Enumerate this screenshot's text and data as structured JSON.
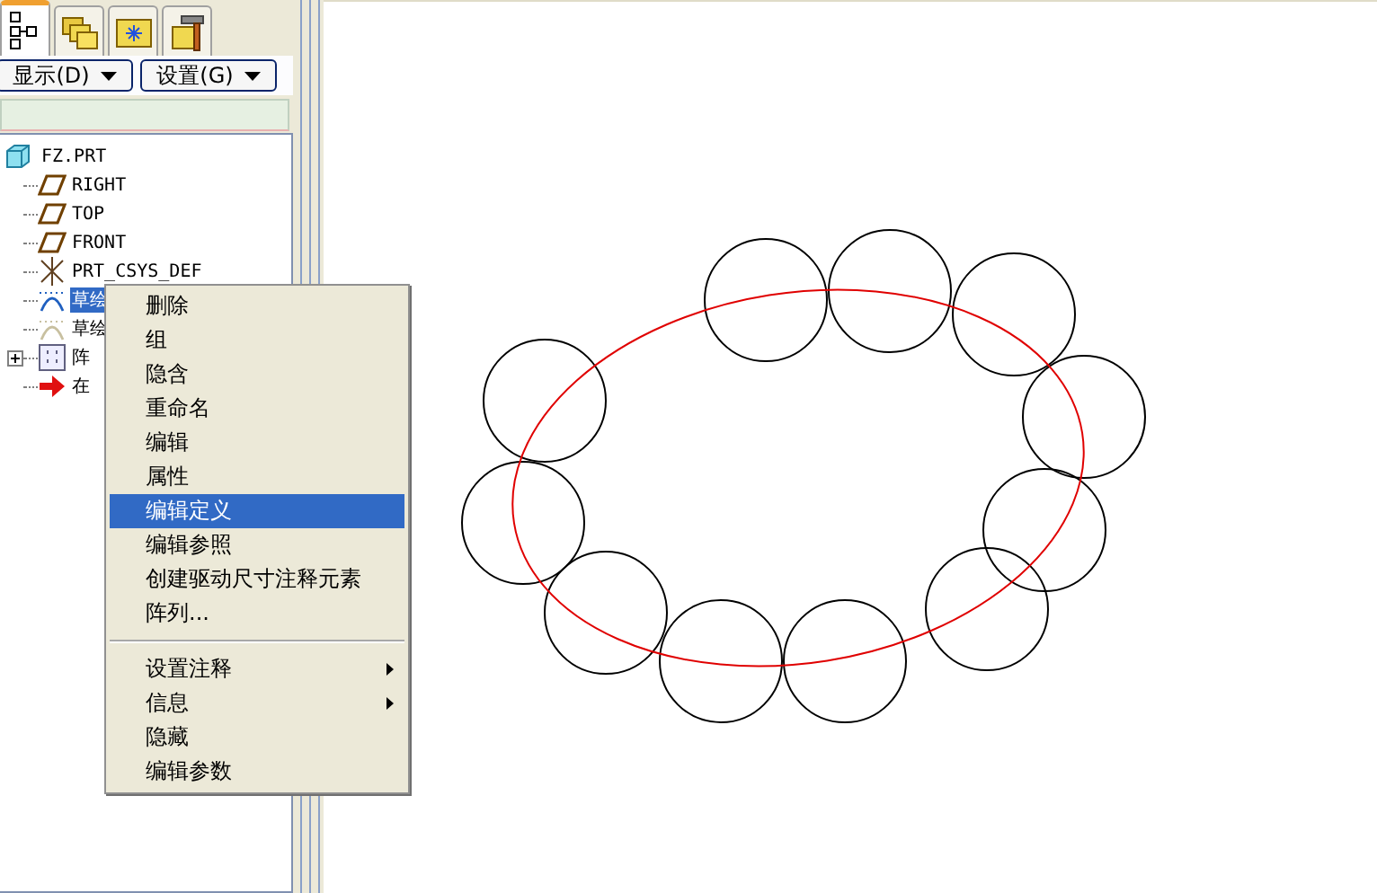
{
  "tabs": [
    {
      "kind": "tree",
      "selected": true
    },
    {
      "kind": "folders",
      "selected": false
    },
    {
      "kind": "star-folder",
      "selected": false
    },
    {
      "kind": "tools",
      "selected": false
    }
  ],
  "toolbar": {
    "buttons": [
      {
        "label": "显示(D)"
      },
      {
        "label": "设置(G)"
      }
    ]
  },
  "tree": {
    "label": "FZ.PRT",
    "kind": "part",
    "children": [
      {
        "label": "RIGHT",
        "kind": "plane",
        "selected": false
      },
      {
        "label": "TOP",
        "kind": "plane",
        "selected": false
      },
      {
        "label": "FRONT",
        "kind": "plane",
        "selected": false
      },
      {
        "label": "PRT_CSYS_DEF",
        "kind": "csys",
        "selected": false
      },
      {
        "label": "草绘",
        "kind": "sketch",
        "selected": true
      },
      {
        "label": "草绘",
        "kind": "sketch-faded",
        "selected": false
      },
      {
        "label": "阵",
        "kind": "pattern",
        "selected": false,
        "expandable": true
      },
      {
        "label": "在",
        "kind": "insert",
        "selected": false
      }
    ]
  },
  "context_menu": {
    "groups": [
      [
        {
          "label": "删除",
          "selected": false
        },
        {
          "label": "组",
          "selected": false
        },
        {
          "label": "隐含",
          "selected": false
        },
        {
          "label": "重命名",
          "selected": false
        },
        {
          "label": "编辑",
          "selected": false
        },
        {
          "label": "属性",
          "selected": false
        },
        {
          "label": "编辑定义",
          "selected": true
        },
        {
          "label": "编辑参照",
          "selected": false
        },
        {
          "label": "创建驱动尺寸注释元素",
          "selected": false
        },
        {
          "label": "阵列...",
          "selected": false
        }
      ],
      [
        {
          "label": "设置注释",
          "selected": false,
          "submenu": true
        },
        {
          "label": "信息",
          "selected": false,
          "submenu": true
        },
        {
          "label": "隐藏",
          "selected": false
        },
        {
          "label": "编辑参数",
          "selected": false
        }
      ]
    ]
  }
}
